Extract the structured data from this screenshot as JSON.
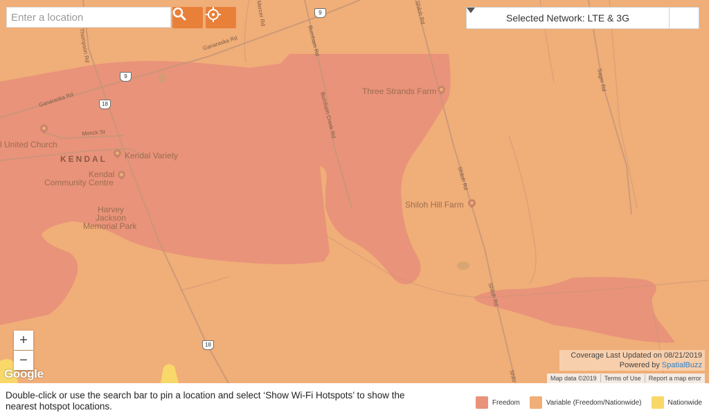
{
  "search": {
    "placeholder": "Enter a location"
  },
  "network": {
    "label": "Selected Network: LTE & 3G"
  },
  "zoom": {
    "in_label": "+",
    "out_label": "−"
  },
  "map": {
    "roads": {
      "ganaraska_rd_top": "Ganaraska Rd",
      "ganaraska_rd_left": "Ganaraska Rd",
      "thompson_rd": "Thompson Rd",
      "mercer_rd": "Mercer Rd",
      "burnham_rd": "Burnham Rd",
      "burnham_creek_rd": "Burnham Creek Rd",
      "shiloh_rd": "Shiloh Rd",
      "shiloh_rd_lower": "Shiloh Rd",
      "shiloh_rd_edge": "Shilo",
      "shiloh_rd_top": "Shiloh Rd",
      "sager_rd": "Sager Rd",
      "monck_st": "Monck St"
    },
    "route_shields": {
      "route_9_top": "9",
      "route_9_mid": "9",
      "route_18_mid": "18",
      "route_18_bottom": "18"
    },
    "places": {
      "three_strands_farm": "Three Strands Farm",
      "shiloh_hill_farm": "Shiloh Hill Farm",
      "united_church": "l United Church",
      "kendal": "KENDAL",
      "kendal_variety": "Kendal Variety",
      "kendal_community_centre_line1": "Kendal",
      "kendal_community_centre_line2": "Community Centre",
      "harvey_jackson_line1": "Harvey",
      "harvey_jackson_line2": "Jackson",
      "harvey_jackson_line3": "Memorial Park"
    },
    "google_logo": "Google"
  },
  "coverage": {
    "updated": "Coverage Last Updated on 08/21/2019",
    "powered_prefix": "Powered by ",
    "powered_link": "SpatialBuzz"
  },
  "attribution": {
    "map_data": "Map data ©2019",
    "terms": "Terms of Use",
    "report": "Report a map error"
  },
  "footer": {
    "instructions": "Double-click or use the search bar to pin a location and select ‘Show Wi-Fi Hotspots’ to show the nearest hotspot locations."
  },
  "legend": [
    {
      "label": "Freedom",
      "color": "#e9937a"
    },
    {
      "label": "Variable (Freedom/Nationwide)",
      "color": "#f0ae78"
    },
    {
      "label": "Nationwide",
      "color": "#f9d86a"
    }
  ],
  "colors": {
    "accent": "#e8803a",
    "freedom": "#e9937a",
    "variable": "#f0ae78",
    "nationwide": "#f9d86a"
  }
}
